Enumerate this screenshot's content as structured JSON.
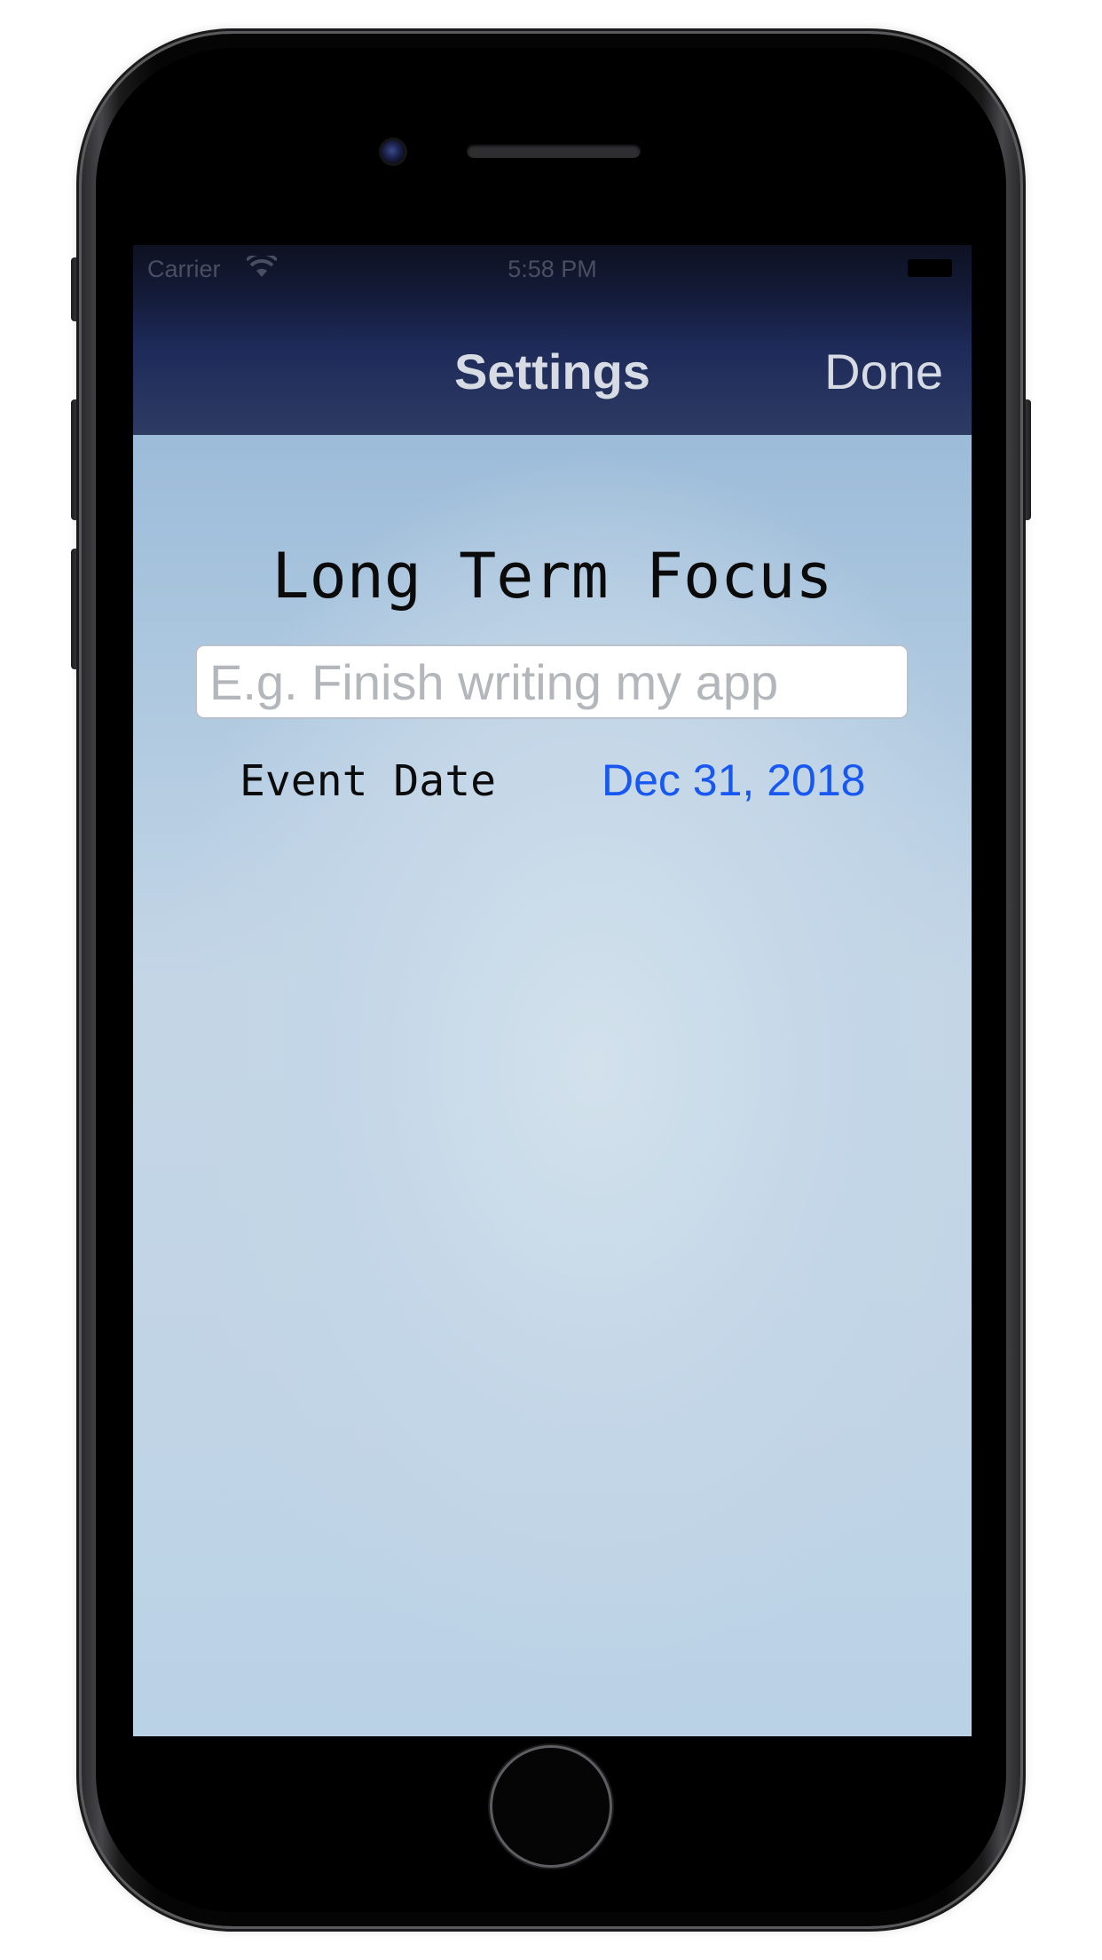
{
  "status_bar": {
    "carrier": "Carrier",
    "time": "5:58 PM"
  },
  "nav_bar": {
    "title": "Settings",
    "done_label": "Done"
  },
  "content": {
    "section_title": "Long Term Focus",
    "focus_input": {
      "value": "",
      "placeholder": "E.g. Finish writing my app"
    },
    "event_date_label": "Event Date",
    "event_date_value": "Dec 31, 2018"
  },
  "colors": {
    "accent": "#1757f2",
    "nav_bar": "#1e2b5a"
  },
  "icons": [
    "wifi-icon",
    "battery-icon"
  ]
}
